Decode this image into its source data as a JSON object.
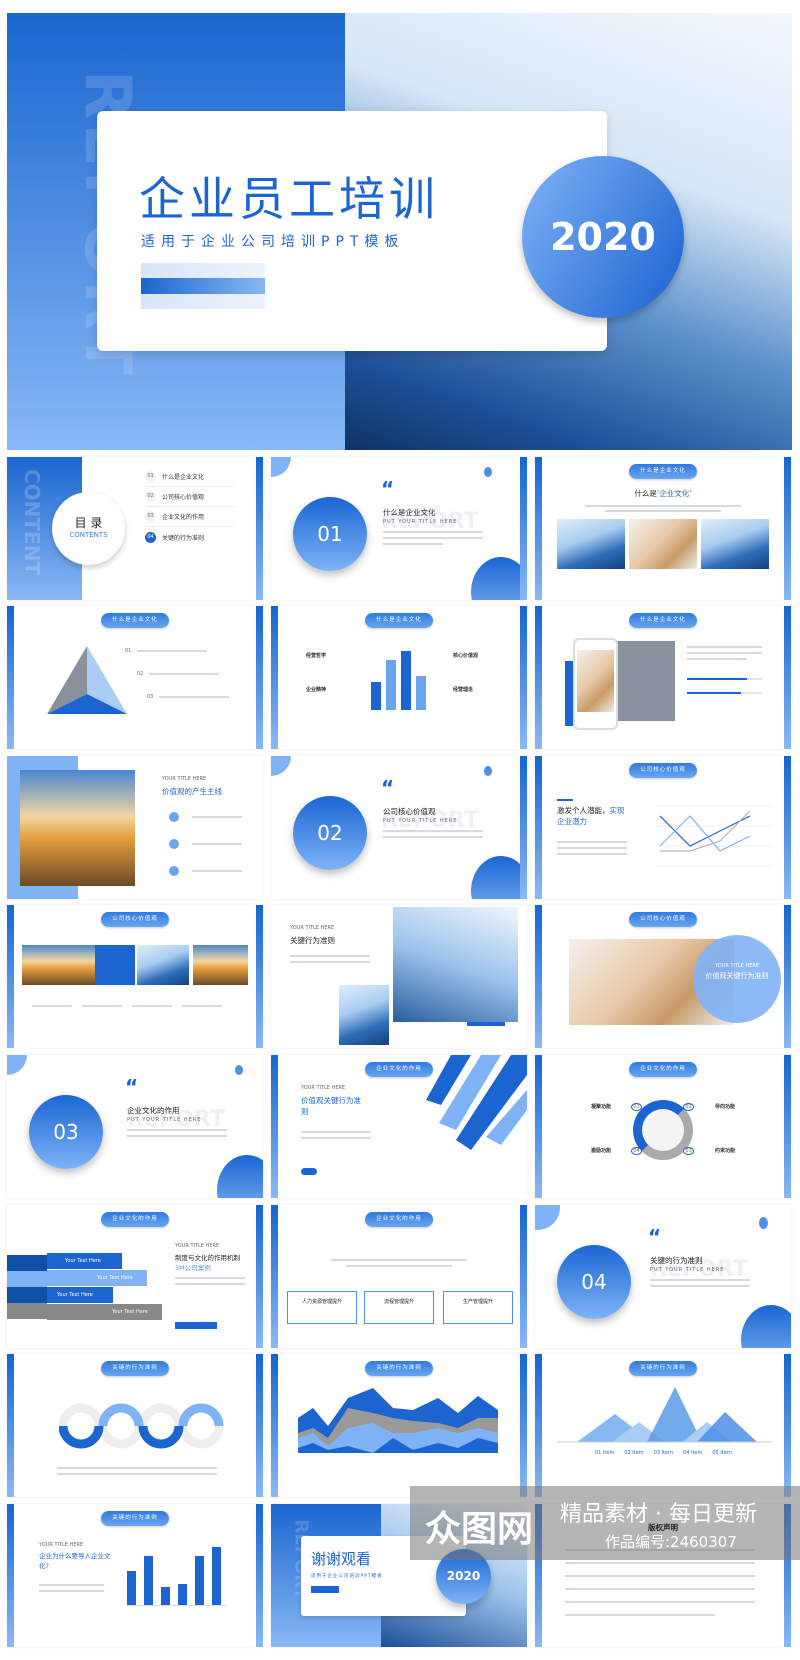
{
  "hero": {
    "watermark": "REPORT",
    "title": "企业员工培训",
    "subtitle": "适用于企业公司培训PPT模板",
    "year": "2020"
  },
  "colors": {
    "primary": "#1c64d0",
    "light": "#7fb3f6",
    "gray": "#8a919c"
  },
  "contents": {
    "watermark": "CONTENT",
    "title": "目 录",
    "subtitle": "CONTENTS",
    "items": [
      {
        "num": "01",
        "label": "什么是企业文化"
      },
      {
        "num": "02",
        "label": "公司核心价值观"
      },
      {
        "num": "03",
        "label": "企业文化的作用"
      },
      {
        "num": "04",
        "label": "关键的行为准则"
      }
    ]
  },
  "sections": [
    {
      "num": "01",
      "title": "什么是企业文化",
      "sub": "PUT YOUR TITLE HERE",
      "bg": "REPORT"
    },
    {
      "num": "02",
      "title": "公司核心价值观",
      "sub": "PUT YOUR TITLE HERE",
      "bg": "REPORT"
    },
    {
      "num": "03",
      "title": "企业文化的作用",
      "sub": "PUT YOUR TITLE HERE",
      "bg": "REPORT"
    },
    {
      "num": "04",
      "title": "关键的行为准则",
      "sub": "PUT YOUR TITLE HERE",
      "bg": "REPORT"
    }
  ],
  "pills": {
    "p1": "什么是企业文化",
    "p2": "公司核心价值观",
    "p3": "企业文化的作用",
    "p4": "关键的行为准则"
  },
  "quote_mark": "“",
  "s3": {
    "title_a": "什么是",
    "title_b": "‘企业文化’"
  },
  "s4": {
    "nums": [
      "01",
      "02",
      "03"
    ]
  },
  "s5": {
    "labels": [
      "经营哲学",
      "企业精神",
      "核心价值观",
      "经营理念"
    ],
    "bars": [
      0.45,
      0.8,
      0.95,
      0.55
    ]
  },
  "s6": {
    "progress": [
      0.8,
      0.72
    ]
  },
  "s7": {
    "kicker": "YOUR TITLE HERE",
    "title": "价值观的产生主线"
  },
  "s9": {
    "title_a": "激发个人潜能，",
    "title_b": "实现",
    "title_c": "企业潜力"
  },
  "s11": {
    "kicker": "YOUR TITLE HERE",
    "title": "关键行为准则"
  },
  "s12": {
    "kicker": "YOUR TITLE HERE",
    "title": "价值观关键行为准则"
  },
  "s14": {
    "kicker": "YOUR TITLE HERE",
    "title": "价值观关键行为准则"
  },
  "s15": {
    "labels": [
      "凝聚功能",
      "导向功能",
      "激励功能",
      "约束功能"
    ],
    "nums": [
      "01",
      "02",
      "04",
      "03"
    ]
  },
  "s16": {
    "kicker": "YOUR TITLE HERE",
    "title": "制度与文化的作用机制",
    "sub": "3M公司案例",
    "bars": [
      "Your Text Here",
      "Your Text Here",
      "Your Text Here",
      "Your Text Here"
    ]
  },
  "s17": {
    "boxes": [
      "人力资源管理提升",
      "流程管理提升",
      "生产管理提升"
    ]
  },
  "s21": {
    "items": [
      "01 Item",
      "02 Item",
      "03 Item",
      "04 Item",
      "05 Item"
    ]
  },
  "s22": {
    "kicker": "YOUR TITLE HERE",
    "title": "企业为什么要导入企业文化?",
    "bars": [
      0.55,
      0.8,
      0.3,
      0.35,
      0.8,
      0.95
    ]
  },
  "s23": {
    "title": "谢谢观看",
    "subtitle": "适用于企业公司培训PPT模板",
    "year": "2020",
    "bg": "REPORT"
  },
  "s24": {
    "title": "版权声明"
  },
  "watermark": {
    "logo": "众图网",
    "slogan": "精品素材 · 每日更新",
    "code": "作品编号:2460307"
  }
}
